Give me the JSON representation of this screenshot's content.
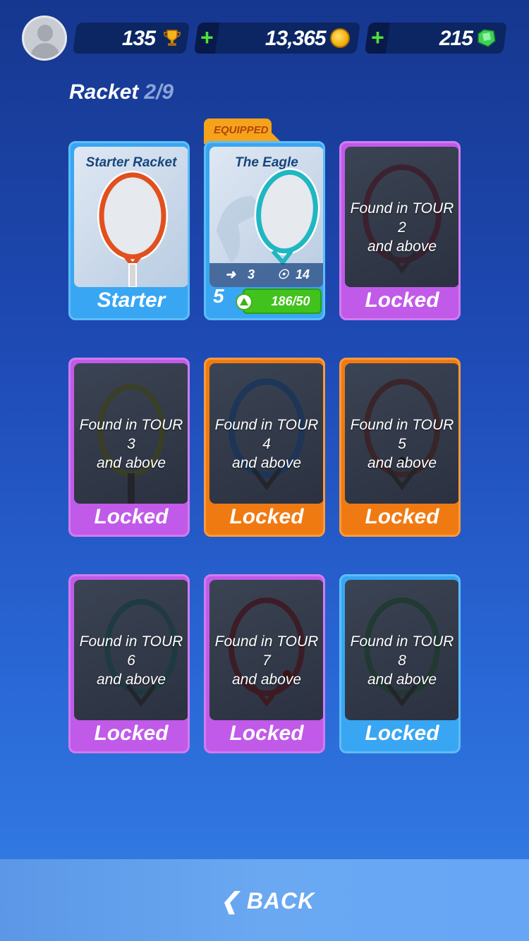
{
  "header": {
    "trophies": "135",
    "coins": "13,365",
    "gems": "215",
    "icons": [
      "avatar-icon",
      "trophy-icon",
      "plus-icon",
      "coin-icon",
      "gem-icon"
    ]
  },
  "section": {
    "title": "Racket",
    "count": "2/9"
  },
  "cards": [
    {
      "title": "Starter Racket",
      "footer": "Starter",
      "theme": "blue",
      "state": "owned"
    },
    {
      "title": "The Eagle",
      "tag": "EQUIPPED",
      "level": "5",
      "progress": "186/50",
      "stat_speed": "3",
      "stat_power": "14",
      "theme": "blue",
      "state": "equipped"
    },
    {
      "lock_line1": "Found in TOUR 2",
      "lock_line2": "and above",
      "footer": "Locked",
      "theme": "purple"
    },
    {
      "lock_line1": "Found in TOUR 3",
      "lock_line2": "and above",
      "footer": "Locked",
      "theme": "purple"
    },
    {
      "lock_line1": "Found in TOUR 4",
      "lock_line2": "and above",
      "footer": "Locked",
      "theme": "orange"
    },
    {
      "lock_line1": "Found in TOUR 5",
      "lock_line2": "and above",
      "footer": "Locked",
      "theme": "orange"
    },
    {
      "lock_line1": "Found in TOUR 6",
      "lock_line2": "and above",
      "footer": "Locked",
      "theme": "purple"
    },
    {
      "lock_line1": "Found in TOUR 7",
      "lock_line2": "and above",
      "footer": "Locked",
      "theme": "purple"
    },
    {
      "lock_line1": "Found in TOUR 8",
      "lock_line2": "and above",
      "footer": "Locked",
      "theme": "blue"
    }
  ],
  "footer": {
    "back_label": "BACK"
  },
  "colors": {
    "card_blue": "#38a6f2",
    "card_purple": "#c15ae8",
    "card_orange": "#f07a12",
    "progress_green": "#41c21c",
    "plus_green": "#4ee23b"
  }
}
